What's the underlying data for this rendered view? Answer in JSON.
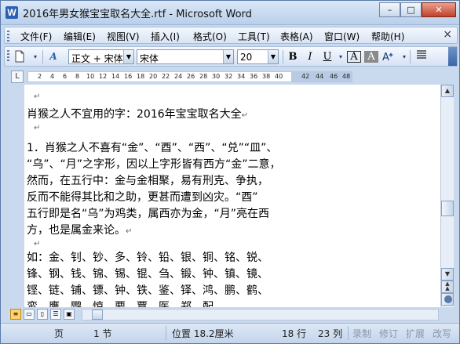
{
  "window": {
    "title": "2016年男女猴宝宝取名大全.rtf - Microsoft Word",
    "app_icon": "W",
    "controls": {
      "minimize": "–",
      "maximize": "□",
      "close": "✕"
    }
  },
  "menu": {
    "items": [
      "文件(F)",
      "编辑(E)",
      "视图(V)",
      "插入(I)",
      "格式(O)",
      "工具(T)",
      "表格(A)",
      "窗口(W)",
      "帮助(H)"
    ],
    "close_doc": "×"
  },
  "toolbar": {
    "style_value": "正文 + 宋体",
    "font_value": "宋体",
    "size_value": "20",
    "bold": "B",
    "italic": "I",
    "underline": "U",
    "border_char": "A",
    "shading_char": "A"
  },
  "ruler": {
    "numbers": [
      "2",
      "4",
      "6",
      "8",
      "10",
      "12",
      "14",
      "16",
      "18",
      "20",
      "22",
      "24",
      "26",
      "28",
      "30",
      "32",
      "34",
      "36",
      "38",
      "40",
      "42",
      "44",
      "46",
      "48"
    ]
  },
  "document": {
    "paragraph_mark": "↵",
    "lines": [
      "",
      "肖猴之人不宜用的字：2016年宝宝取名大全",
      "",
      "1．肖猴之人不喜有“金”、“酉”、“西”、“兑”“皿”、",
      "“乌”、“月”之字形，因以上字形皆有西方“金”二意，",
      "然而，在五行中：金与金相聚，易有刑克、争执，",
      "反而不能得其比和之助，更甚而遭到凶灾。“酉”",
      "五行即是名“乌”为鸡类，属西亦为金，“月”亮在西",
      "方，也是属金来论。",
      "",
      "如：金、钊、钞、多、铃、铅、银、铜、铭、锐、",
      "锋、钢、钱、锦、锡、锟、刍、锻、钟、镇、镜、",
      "铿、链、铺、镖、钟、铁、鉴、铎、鸿、鹏、鹤、",
      "鸾、鹰、鹦、惊、要、覃、医、郑、配。"
    ]
  },
  "statusbar": {
    "page": "页",
    "section": "1 节",
    "position": "位置 18.2厘米",
    "line": "18 行",
    "column": "23 列",
    "rec": "录制",
    "trk": "修订",
    "ext": "扩展",
    "ovr": "改写"
  }
}
